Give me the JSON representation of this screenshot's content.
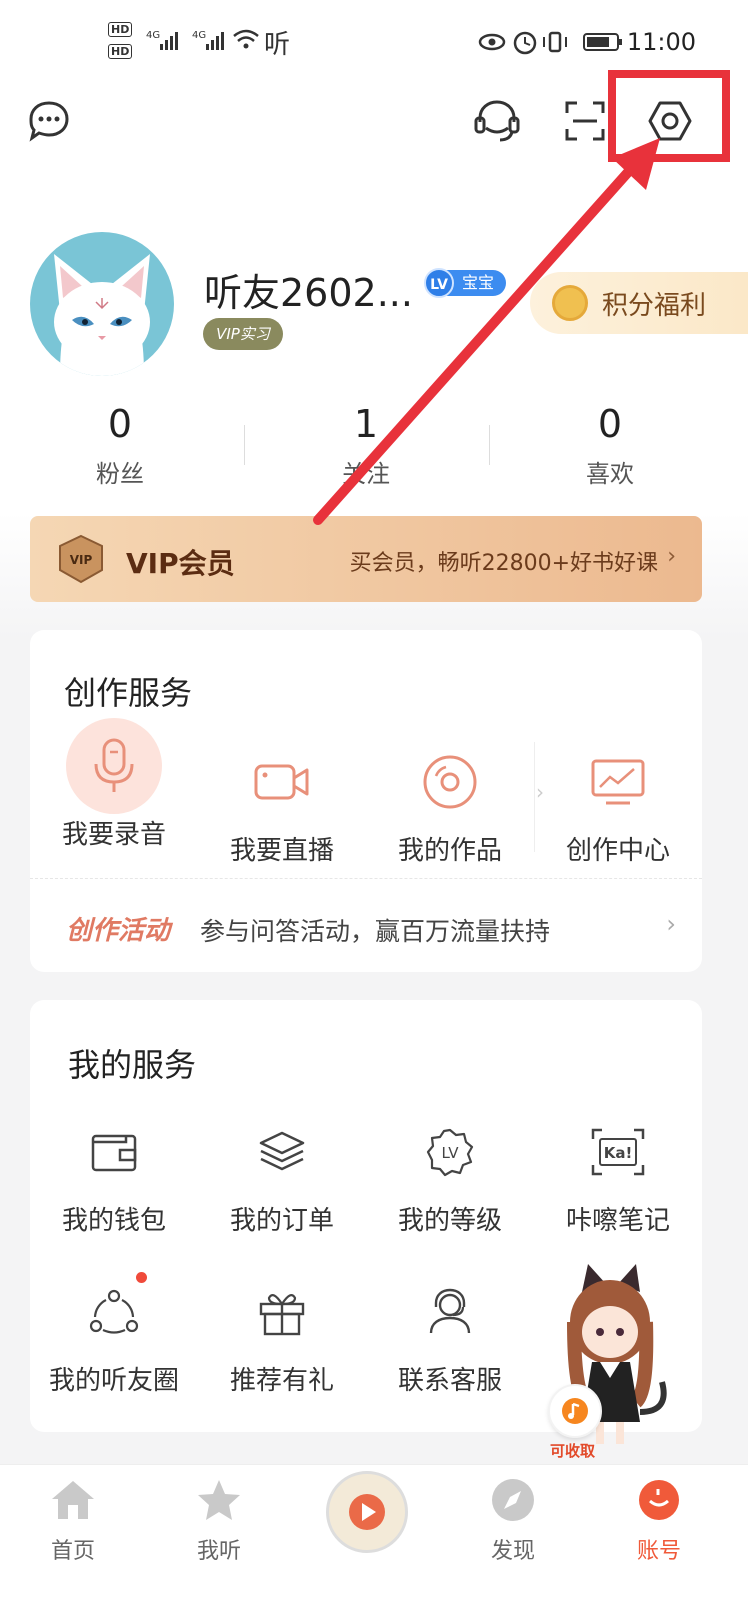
{
  "status_bar": {
    "hd1": "HD",
    "hd2": "HD",
    "network": "4G 4G",
    "listen_glyph": "听",
    "time": "11:00"
  },
  "header": {
    "icons": [
      "message-icon",
      "headset-icon",
      "scan-icon",
      "settings-icon"
    ]
  },
  "profile": {
    "username": "听友2602...",
    "level_badge": "LV",
    "level_name": "宝宝",
    "vip_tag": "VIP实习",
    "points_label": "积分福利"
  },
  "stats": [
    {
      "value": "0",
      "label": "粉丝"
    },
    {
      "value": "1",
      "label": "关注"
    },
    {
      "value": "0",
      "label": "喜欢"
    }
  ],
  "vip_bar": {
    "badge": "VIP",
    "title": "VIP会员",
    "desc": "买会员，畅听22800+好书好课"
  },
  "creation_service": {
    "title": "创作服务",
    "items": [
      {
        "label": "我要录音",
        "icon": "microphone-icon"
      },
      {
        "label": "我要直播",
        "icon": "video-camera-icon"
      },
      {
        "label": "我的作品",
        "icon": "disc-icon"
      },
      {
        "label": "创作中心",
        "icon": "monitor-chart-icon"
      }
    ],
    "activity_tag": "创作活动",
    "activity_text": "参与问答活动，赢百万流量扶持"
  },
  "my_service": {
    "title": "我的服务",
    "items": [
      {
        "label": "我的钱包",
        "icon": "wallet-icon"
      },
      {
        "label": "我的订单",
        "icon": "layers-icon"
      },
      {
        "label": "我的等级",
        "icon": "level-badge-icon"
      },
      {
        "label": "咔嚓笔记",
        "icon": "ka-note-icon"
      },
      {
        "label": "我的听友圈",
        "icon": "friends-circle-icon"
      },
      {
        "label": "推荐有礼",
        "icon": "gift-icon"
      },
      {
        "label": "联系客服",
        "icon": "customer-service-icon"
      }
    ],
    "mascot_label": "可收取"
  },
  "tabbar": {
    "tabs": [
      {
        "label": "首页",
        "icon": "home-icon"
      },
      {
        "label": "我听",
        "icon": "star-icon"
      },
      {
        "label": "",
        "icon": "now-playing-icon"
      },
      {
        "label": "发现",
        "icon": "compass-icon"
      },
      {
        "label": "账号",
        "icon": "account-icon"
      }
    ]
  },
  "colors": {
    "accent": "#e8323b",
    "creation_icon": "#e8907a",
    "vip_text": "#5b2c12",
    "tab_active": "#f05a3a"
  }
}
